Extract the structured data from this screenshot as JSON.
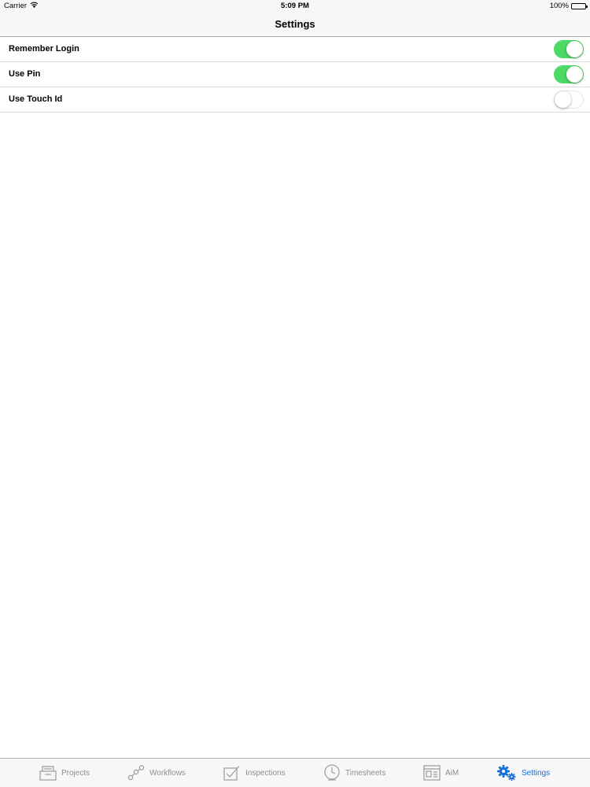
{
  "status_bar": {
    "carrier": "Carrier",
    "time": "5:09 PM",
    "battery": "100%"
  },
  "nav": {
    "title": "Settings"
  },
  "settings": [
    {
      "label": "Remember Login",
      "enabled": true
    },
    {
      "label": "Use Pin",
      "enabled": true
    },
    {
      "label": "Use Touch Id",
      "enabled": false
    }
  ],
  "tabs": [
    {
      "label": "Projects",
      "icon": "projects-icon"
    },
    {
      "label": "Workflows",
      "icon": "workflows-icon"
    },
    {
      "label": "Inspections",
      "icon": "inspections-icon"
    },
    {
      "label": "Timesheets",
      "icon": "timesheets-icon"
    },
    {
      "label": "AiM",
      "icon": "aim-icon"
    },
    {
      "label": "Settings",
      "icon": "gear-icon",
      "active": true
    }
  ],
  "colors": {
    "switch_on": "#4cd964",
    "tab_active": "#1a6fd6",
    "tab_inactive": "#8e8e93"
  }
}
